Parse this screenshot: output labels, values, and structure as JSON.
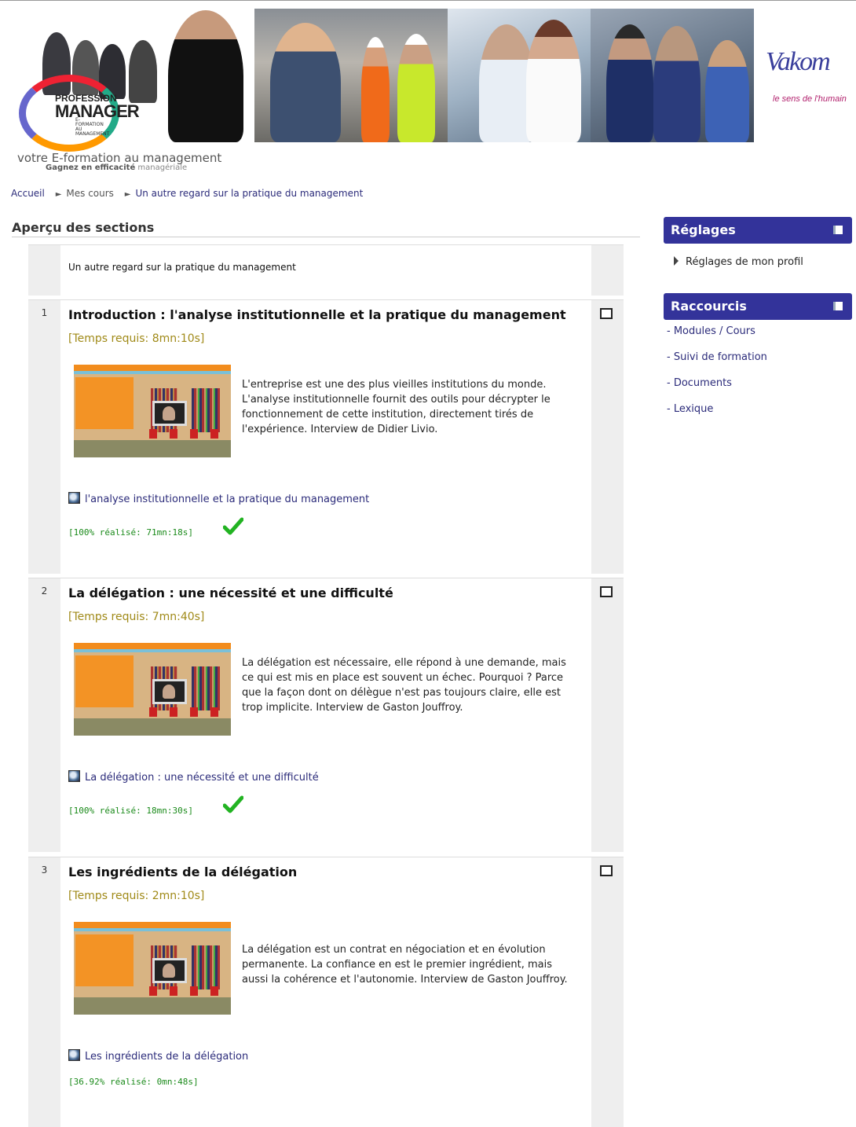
{
  "header": {
    "logo_line1": "PROFESSION",
    "logo_line2": "MANAGER",
    "logo_line3": "E-FORMATION AU MANAGEMENT",
    "tagline": "votre E-formation au management",
    "subtagline_a": "Gagnez en efficacité",
    "subtagline_b": "managériale",
    "partner_logo": "Vakom",
    "partner_tagline": "le sens de l'humain"
  },
  "breadcrumb": {
    "home": "Accueil",
    "courses": "Mes cours",
    "current": "Un autre regard sur la pratique du management"
  },
  "page": {
    "title": "Aperçu des sections"
  },
  "section0": {
    "title": "Un autre regard sur la pratique du management"
  },
  "sections": [
    {
      "number": "1",
      "title": "Introduction : l'analyse institutionnelle et la pratique du management",
      "time": "[Temps requis: 8mn:10s]",
      "description": "L'entreprise est une des plus vieilles institutions du monde. L'analyse institutionnelle fournit des outils pour décrypter le fonctionnement de cette institution, directement tirés de l'expérience. Interview de Didier Livio.",
      "link": "l'analyse institutionnelle et la pratique du management",
      "progress": "[100% réalisé: 71mn:18s]",
      "completed": true
    },
    {
      "number": "2",
      "title": "La délégation : une nécessité et une difficulté",
      "time": "[Temps requis: 7mn:40s]",
      "description": "La délégation est nécessaire, elle répond à une demande, mais ce qui est mis en place est souvent un échec. Pourquoi ? Parce que la façon dont on délègue n'est pas toujours claire, elle est trop implicite. Interview de Gaston Jouffroy.",
      "link": "La délégation : une nécessité et une difficulté",
      "progress": "[100% réalisé: 18mn:30s]",
      "completed": true
    },
    {
      "number": "3",
      "title": "Les ingrédients de la délégation",
      "time": "[Temps requis: 2mn:10s]",
      "description": "La délégation est un contrat en négociation et en évolution permanente. La confiance en est le premier ingrédient, mais aussi la cohérence et l'autonomie. Interview de Gaston Jouffroy.",
      "link": "Les ingrédients de la délégation",
      "progress": "[36.92% réalisé: 0mn:48s]",
      "completed": false
    }
  ],
  "sidebar": {
    "settings": {
      "title": "Réglages",
      "items": [
        "Réglages de mon profil"
      ]
    },
    "shortcuts": {
      "title": "Raccourcis",
      "items": [
        "- Modules / Cours",
        "- Suivi de formation",
        "- Documents",
        "- Lexique"
      ]
    }
  },
  "colors": {
    "accent": "#33339a",
    "link": "#2b2b7a",
    "time": "#a08a18",
    "progress": "#1a8a1a"
  }
}
